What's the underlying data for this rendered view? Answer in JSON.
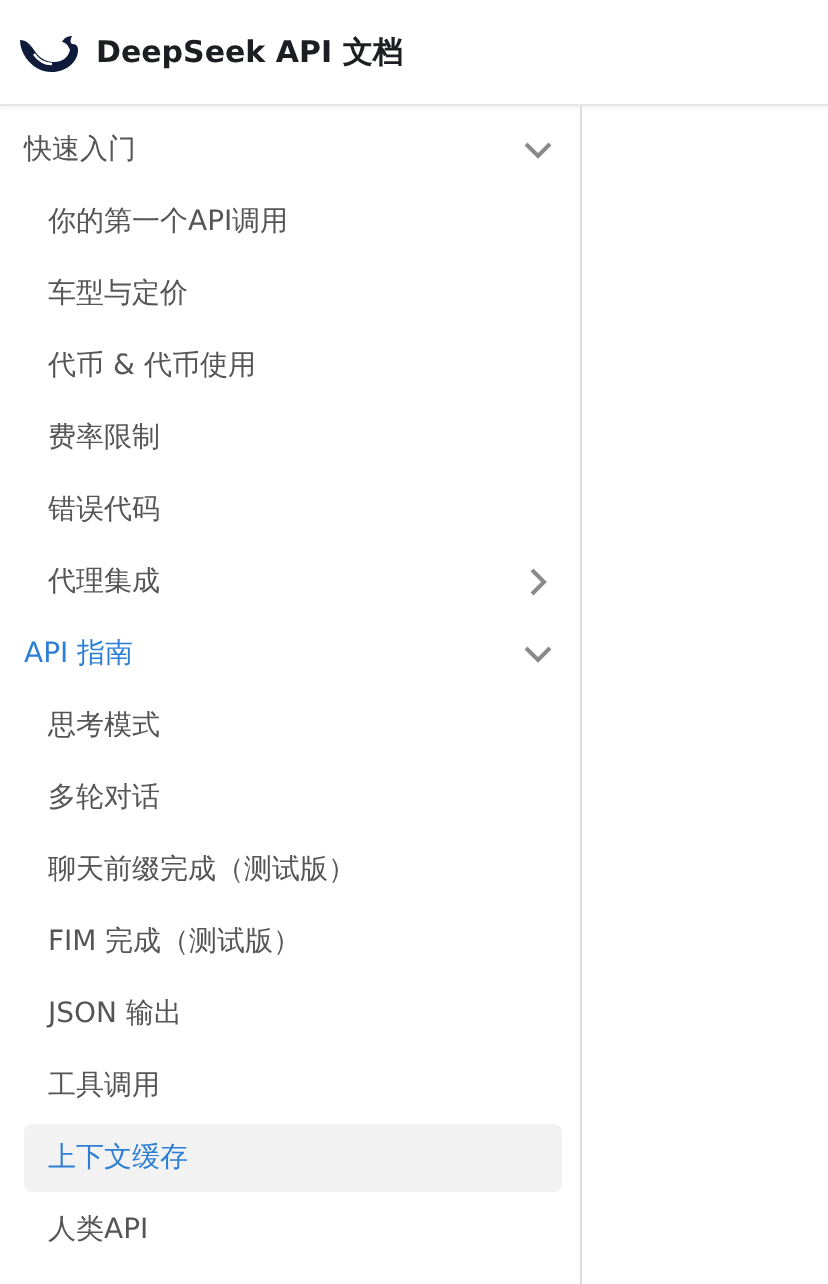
{
  "header": {
    "title": "DeepSeek API 文档"
  },
  "sidebar": {
    "sections": [
      {
        "label": "快速入门",
        "expanded": true,
        "active": false,
        "items": [
          {
            "label": "你的第一个API调用",
            "selected": false
          },
          {
            "label": "车型与定价",
            "selected": false
          },
          {
            "label": "代币 & 代币使用",
            "selected": false
          },
          {
            "label": "费率限制",
            "selected": false
          },
          {
            "label": "错误代码",
            "selected": false
          },
          {
            "label": "代理集成",
            "selected": false,
            "expanded": false
          }
        ]
      },
      {
        "label": "API 指南",
        "expanded": true,
        "active": true,
        "items": [
          {
            "label": "思考模式",
            "selected": false
          },
          {
            "label": "多轮对话",
            "selected": false
          },
          {
            "label": "聊天前缀完成（测试版）",
            "selected": false
          },
          {
            "label": "FIM 完成（测试版）",
            "selected": false
          },
          {
            "label": "JSON 输出",
            "selected": false
          },
          {
            "label": "工具调用",
            "selected": false
          },
          {
            "label": "上下文缓存",
            "selected": true
          },
          {
            "label": "人类API",
            "selected": false
          }
        ]
      }
    ]
  }
}
